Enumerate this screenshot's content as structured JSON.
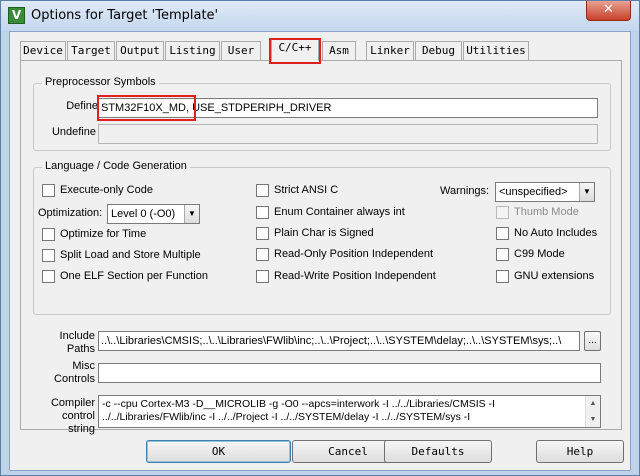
{
  "window": {
    "title": "Options for Target 'Template'",
    "app_icon_glyph": "V",
    "close_glyph": "✕"
  },
  "tabs": [
    {
      "label": "Device"
    },
    {
      "label": "Target"
    },
    {
      "label": "Output"
    },
    {
      "label": "Listing"
    },
    {
      "label": "User"
    },
    {
      "label": "C/C++",
      "active": true
    },
    {
      "label": "Asm"
    },
    {
      "label": "Linker"
    },
    {
      "label": "Debug"
    },
    {
      "label": "Utilities"
    }
  ],
  "preprocessor": {
    "group_title": "Preprocessor Symbols",
    "define_label": "Define",
    "define_value": "STM32F10X_MD, USE_STDPERIPH_DRIVER",
    "undefine_label": "Undefine",
    "undefine_value": ""
  },
  "language": {
    "group_title": "Language / Code Generation",
    "execute_only": "Execute-only Code",
    "optimization_label": "Optimization:",
    "optimization_value": "Level 0 (-O0)",
    "optimize_time": "Optimize for Time",
    "split_load": "Split Load and Store Multiple",
    "one_elf": "One ELF Section per Function",
    "strict_ansi": "Strict ANSI C",
    "enum_container": "Enum Container always int",
    "plain_char": "Plain Char is Signed",
    "ro_pos": "Read-Only Position Independent",
    "rw_pos": "Read-Write Position Independent",
    "warnings_label": "Warnings:",
    "warnings_value": "<unspecified>",
    "thumb_mode": "Thumb Mode",
    "no_auto_includes": "No Auto Includes",
    "c99_mode": "C99 Mode",
    "gnu_extensions": "GNU extensions"
  },
  "paths": {
    "include_label_1": "Include",
    "include_label_2": "Paths",
    "include_value": "..\\..\\Libraries\\CMSIS;..\\..\\Libraries\\FWlib\\inc;..\\..\\Project;..\\..\\SYSTEM\\delay;..\\..\\SYSTEM\\sys;..\\",
    "browse_label": "...",
    "misc_label_1": "Misc",
    "misc_label_2": "Controls",
    "misc_value": "",
    "compiler_label_1": "Compiler",
    "compiler_label_2": "control",
    "compiler_label_3": "string",
    "compiler_line_1": "-c --cpu Cortex-M3 -D__MICROLIB -g -O0 --apcs=interwork -I ../../Libraries/CMSIS -I",
    "compiler_line_2": "../../Libraries/FWlib/inc -I ../../Project -I ../../SYSTEM/delay -I ../../SYSTEM/sys -I"
  },
  "buttons": {
    "ok": "OK",
    "cancel": "Cancel",
    "defaults": "Defaults",
    "help": "Help"
  }
}
